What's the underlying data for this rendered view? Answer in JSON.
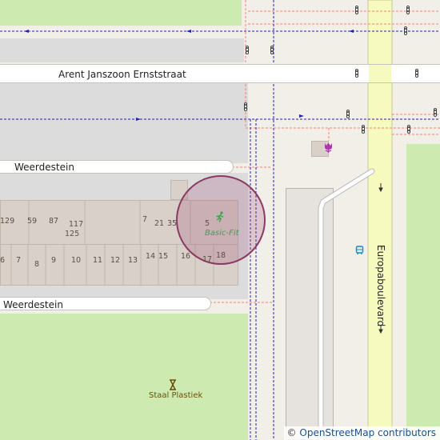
{
  "map": {
    "streets": [
      {
        "id": "arent",
        "label": "Arent Janszoon Ernststraat"
      },
      {
        "id": "weerdestein-upper",
        "label": "Weerdestein"
      },
      {
        "id": "weerdestein-lower",
        "label": "Weerdestein"
      },
      {
        "id": "europaboulevard",
        "label": "Europaboulevard"
      }
    ],
    "house_numbers": [
      "129",
      "59",
      "87",
      "117",
      "125",
      "7",
      "21",
      "35",
      "5",
      "6",
      "7",
      "8",
      "9",
      "10",
      "11",
      "12",
      "13",
      "14",
      "15",
      "16",
      "17",
      "18"
    ],
    "pois": {
      "fitness": {
        "label": "Basic-Fit",
        "icon": "running-person-icon",
        "color": "#39a34a"
      },
      "shop": {
        "label": "Staal Plastiek",
        "icon": "hourglass-icon",
        "color": "#6b4e0a"
      },
      "bus_stop": {
        "icon": "bus-stop-icon",
        "color": "#0092da"
      },
      "flower_shop": {
        "icon": "tulip-icon",
        "color": "#ac39ac"
      }
    },
    "marker": {
      "type": "location-circle",
      "color": "#a0507a"
    },
    "colors": {
      "background": "#f2efe9",
      "park": "#cdebb0",
      "building": "#d9d0c9",
      "primary_road": "#f7fabf",
      "bus_route": "#1f1fb5",
      "footpath": "#fa8072"
    },
    "attribution": {
      "symbol": "©",
      "text": "OpenStreetMap contributors"
    }
  }
}
